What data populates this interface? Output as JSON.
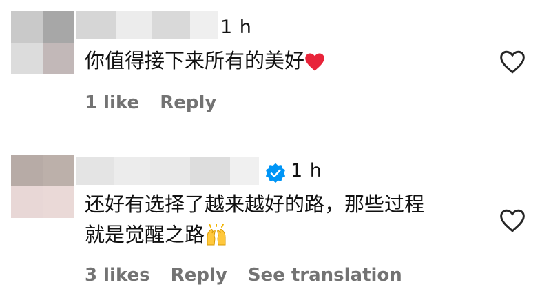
{
  "comments": [
    {
      "time": "1 h",
      "verified": false,
      "lines": [
        "你值得接下来所有的美好"
      ],
      "emoji": "heart",
      "actions": {
        "likes": "1 like",
        "reply": "Reply"
      }
    },
    {
      "time": "1 h",
      "verified": true,
      "lines": [
        "还好有选择了越来越好的路，那些过程",
        "就是觉醒之路"
      ],
      "emoji": "raising-hands",
      "actions": {
        "likes": "3 likes",
        "reply": "Reply",
        "translate": "See translation"
      }
    }
  ],
  "colors": {
    "text": "#111111",
    "secondary": "#737373",
    "verified_blue": "#0095F6",
    "heart_red": "#E8243A",
    "heart_outline": "#262626"
  },
  "icons": [
    "heart-icon",
    "verified-badge-icon",
    "like-heart-outline-icon",
    "raising-hands-emoji-icon"
  ]
}
